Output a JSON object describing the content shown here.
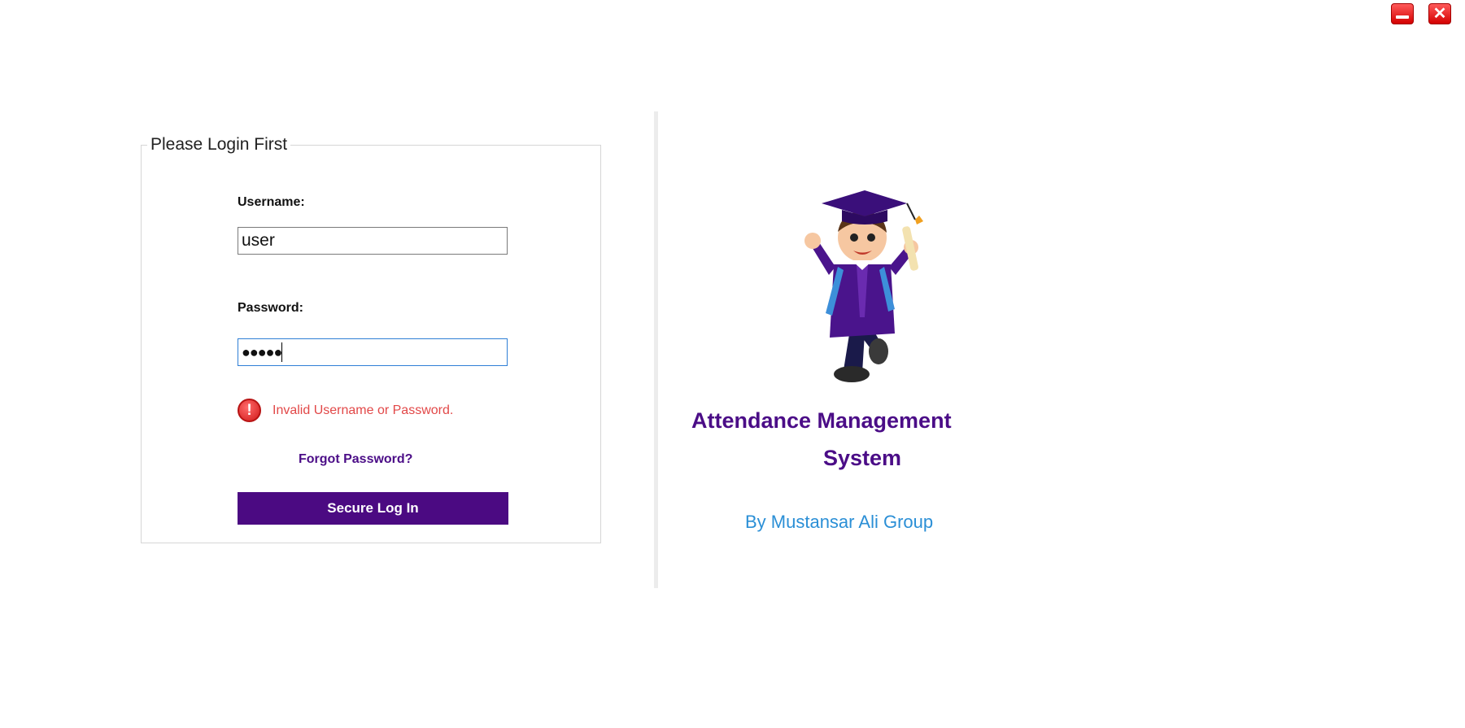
{
  "window": {
    "minimize_icon": "minimize-icon",
    "close_icon": "close-icon"
  },
  "login": {
    "group_title": "Please Login First",
    "username_label": "Username:",
    "username_value": "user",
    "password_label": "Password:",
    "password_mask": "●●●●●",
    "error_icon": "error-icon",
    "error_text": "Invalid Username or Password.",
    "forgot_link": "Forgot Password?",
    "login_button": "Secure Log In"
  },
  "branding": {
    "title_line1": "Attendance Management",
    "title_line2": "System",
    "byline": "By Mustansar Ali  Group",
    "mascot_icon": "graduate-mascot-icon"
  },
  "colors": {
    "accent": "#4b0a82",
    "error": "#e24848",
    "byline": "#2b8fd6",
    "window_button": "#d40000"
  }
}
